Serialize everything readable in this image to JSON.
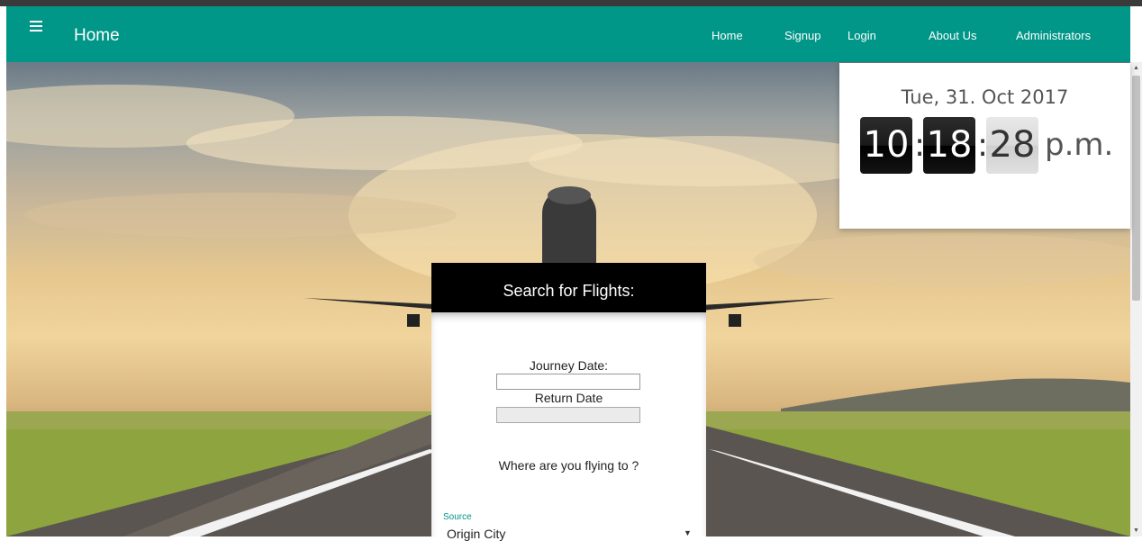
{
  "navbar": {
    "brand": "Home",
    "links": [
      "Home",
      "Signup",
      "Login",
      "About Us",
      "Administrators"
    ]
  },
  "clock": {
    "date": "Tue, 31. Oct 2017",
    "hours": "10",
    "minutes": "18",
    "seconds": "28",
    "separator": ":",
    "ampm": "p.m."
  },
  "search": {
    "title": "Search for Flights:",
    "journey_date_label": "Journey Date:",
    "journey_date_value": "",
    "return_date_label": "Return Date",
    "return_date_value": "",
    "question": "Where are you flying to ?",
    "source_label": "Source",
    "source_value": "Origin City",
    "source_caret": "▼"
  },
  "scrollbar": {
    "up_arrow": "▲",
    "down_arrow": "▼"
  },
  "colors": {
    "navbar": "#009688",
    "accent": "#009688",
    "search_header": "#000000"
  },
  "icons": [
    "menu-icon",
    "dropdown-caret-icon"
  ]
}
